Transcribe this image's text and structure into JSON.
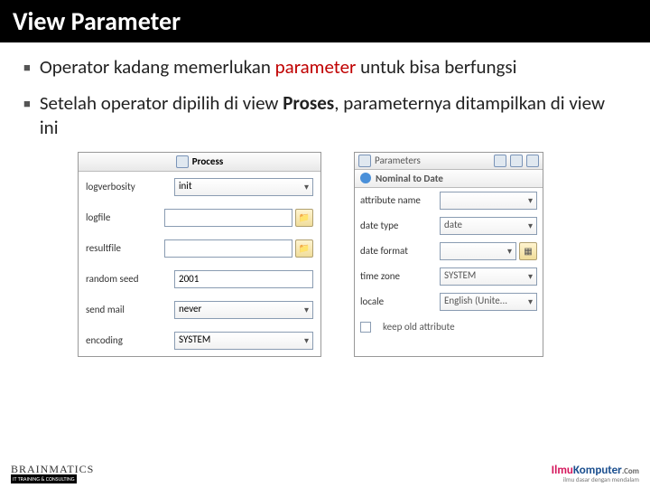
{
  "title": "View Parameter",
  "bullets": [
    {
      "pre": "Operator kadang memerlukan ",
      "red": "parameter",
      "post": " untuk bisa berfungsi"
    },
    {
      "pre": "Setelah operator dipilih di view ",
      "bold": "Proses",
      "post": ", parameternya ditampilkan di view ini"
    }
  ],
  "left": {
    "header": "Process",
    "rows": [
      {
        "label": "logverbosity",
        "type": "select",
        "value": "init"
      },
      {
        "label": "logfile",
        "type": "file",
        "value": ""
      },
      {
        "label": "resultfile",
        "type": "file",
        "value": ""
      },
      {
        "label": "random seed",
        "type": "input",
        "value": "2001"
      },
      {
        "label": "send mail",
        "type": "select",
        "value": "never"
      },
      {
        "label": "encoding",
        "type": "select",
        "value": "SYSTEM"
      }
    ]
  },
  "right": {
    "tab": "Parameters",
    "sub": "Nominal to Date",
    "rows": [
      {
        "label": "attribute name",
        "type": "select",
        "value": ""
      },
      {
        "label": "date type",
        "type": "select",
        "value": "date"
      },
      {
        "label": "date format",
        "type": "file",
        "value": ""
      },
      {
        "label": "time zone",
        "type": "select",
        "value": "SYSTEM"
      },
      {
        "label": "locale",
        "type": "select",
        "value": "English (Unite..."
      }
    ],
    "checkbox": "keep old attribute"
  },
  "footer": {
    "left_big": "BRAINMATICS",
    "left_sm": "IT TRAINING & CONSULTING",
    "right_il": "Ilmu",
    "right_ko": "Komputer",
    "right_com": ".Com",
    "right_sm": "ilmu dasar dengan mendalam"
  }
}
